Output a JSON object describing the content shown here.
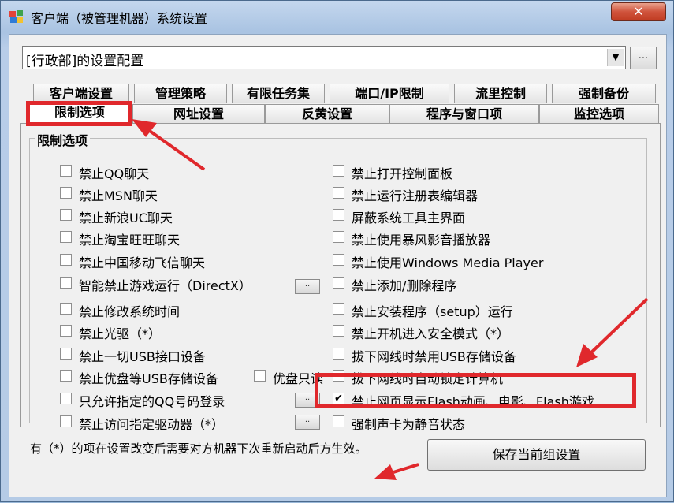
{
  "window": {
    "title": "客户端（被管理机器）系统设置",
    "close_label": "✕"
  },
  "config_combo": {
    "value": "[行政部]的设置配置",
    "more_label": "..."
  },
  "tabs_row1": [
    "客户端设置",
    "管理策略",
    "有限任务集",
    "端口/IP限制",
    "流里控制",
    "强制备份"
  ],
  "tabs_row2": [
    "限制选项",
    "网址设置",
    "反黄设置",
    "程序与窗口项",
    "监控选项"
  ],
  "active_tab": "限制选项",
  "group_title": "限制选项",
  "left_options": [
    {
      "label": "禁止QQ聊天",
      "checked": false
    },
    {
      "label": "禁止MSN聊天",
      "checked": false
    },
    {
      "label": "禁止新浪UC聊天",
      "checked": false
    },
    {
      "label": "禁止淘宝旺旺聊天",
      "checked": false
    },
    {
      "label": "禁止中国移动飞信聊天",
      "checked": false
    },
    {
      "label": "智能禁止游戏运行（DirectX）",
      "checked": false
    },
    {
      "label": "禁止修改系统时间",
      "checked": false
    },
    {
      "label": "禁止光驱（*）",
      "checked": false
    },
    {
      "label": "禁止一切USB接口设备",
      "checked": false
    },
    {
      "label": "禁止优盘等USB存储设备",
      "checked": false
    },
    {
      "label": "只允许指定的QQ号码登录",
      "checked": false
    },
    {
      "label": "禁止访问指定驱动器（*）",
      "checked": false
    }
  ],
  "usb_readonly": {
    "label": "优盘只读",
    "checked": false
  },
  "right_options": [
    {
      "label": "禁止打开控制面板",
      "checked": false
    },
    {
      "label": "禁止运行注册表编辑器",
      "checked": false
    },
    {
      "label": "屏蔽系统工具主界面",
      "checked": false
    },
    {
      "label": "禁止使用暴风影音播放器",
      "checked": false
    },
    {
      "label": "禁止使用Windows Media Player",
      "checked": false
    },
    {
      "label": "禁止添加/删除程序",
      "checked": false
    },
    {
      "label": "禁止安装程序（setup）运行",
      "checked": false
    },
    {
      "label": "禁止开机进入安全模式（*）",
      "checked": false
    },
    {
      "label": "拔下网线时禁用USB存储设备",
      "checked": false
    },
    {
      "label": "拔下网线时自动锁定计算机",
      "checked": false
    },
    {
      "label": "禁止网页显示Flash动画、电影、Flash游戏",
      "checked": true
    },
    {
      "label": "强制声卡为静音状态",
      "checked": false
    }
  ],
  "mini_button_label": "..",
  "footer_note": "有（*）的项在设置改变后需要对方机器下次重新启动后方生效。",
  "save_button": "保存当前组设置",
  "colors": {
    "highlight": "#e0282c"
  }
}
